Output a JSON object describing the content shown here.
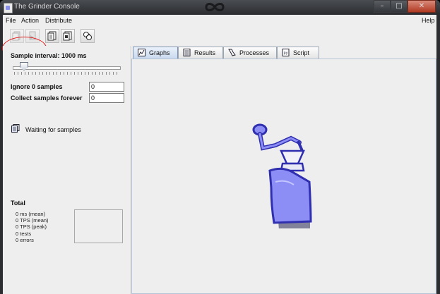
{
  "window": {
    "title": "The Grinder Console"
  },
  "menu": {
    "file": "File",
    "action": "Action",
    "distribute": "Distribute",
    "help": "Help"
  },
  "toolbar": {
    "buttons": [
      {
        "icon": "start-processes-icon",
        "enabled": false
      },
      {
        "icon": "reset-processes-icon",
        "enabled": false
      },
      {
        "icon": "start-capture-icon",
        "enabled": true
      },
      {
        "icon": "stop-capture-icon",
        "enabled": true
      },
      {
        "icon": "save-results-icon",
        "enabled": true
      }
    ]
  },
  "sampling": {
    "interval_label": "Sample interval: 1000 ms",
    "slider_value": 1000,
    "ignore_label": "Ignore 0 samples",
    "ignore_value": "0",
    "collect_label": "Collect samples forever",
    "collect_value": "0"
  },
  "status": {
    "text": "Waiting for samples",
    "icon": "status-document-icon"
  },
  "total": {
    "label": "Total",
    "stats": [
      "0 ms (mean)",
      "0 TPS (mean)",
      "0 TPS (peak)",
      "0 tests",
      "0 errors"
    ]
  },
  "tabs": [
    {
      "label": "Graphs",
      "icon": "graphs-icon",
      "active": true
    },
    {
      "label": "Results",
      "icon": "results-icon",
      "active": false
    },
    {
      "label": "Processes",
      "icon": "processes-icon",
      "active": false
    },
    {
      "label": "Script",
      "icon": "script-icon",
      "active": false
    }
  ],
  "colors": {
    "grinder": "#8c8ef5",
    "grinder_outline": "#2f2fb0",
    "highlight": "#e0201e"
  }
}
